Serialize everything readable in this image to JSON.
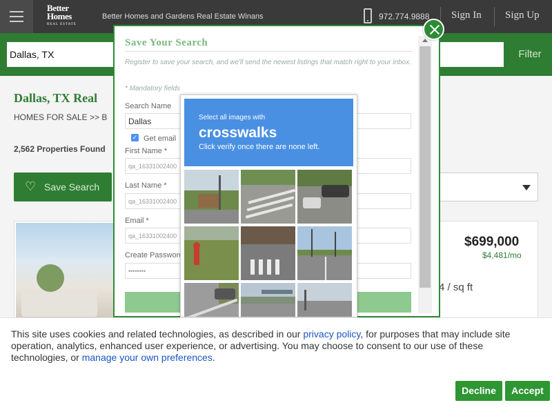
{
  "header": {
    "logo_line1": "Better",
    "logo_line2": "Homes",
    "logo_line3": "and Gardens",
    "logo_line4": "REAL ESTATE",
    "brand": "Better Homes and Gardens Real Estate Winans",
    "phone": "972.774.9888",
    "sign_in": "Sign In",
    "sign_up": "Sign Up"
  },
  "search": {
    "value": "Dallas, TX",
    "filter_label": "Filter"
  },
  "page": {
    "title": "Dallas, TX Real",
    "crumb": "HOMES FOR SALE  >>  B",
    "count": "2,562 Properties Found",
    "save_search": "Save Search"
  },
  "listing": {
    "price": "$699,000",
    "per_month": "$4,481/mo",
    "sqft_fragment": "4 / sq ft"
  },
  "modal": {
    "title": "Save Your Search",
    "intro": "Register to save your search, and we'll send the newest listings that match right to your inbox.",
    "mandatory": "* Mandatory fields",
    "search_name_label": "Search Name",
    "search_name_value": "Dallas",
    "get_email_label": "Get email",
    "first_name_label": "First Name *",
    "first_name_value": "qa_16331002400",
    "last_name_label": "Last Name *",
    "last_name_value": "qa_16331002400",
    "email_label": "Email *",
    "email_value": "qa_16331002400",
    "password_label": "Create Password",
    "password_value": "••••••••"
  },
  "captcha": {
    "instruction_small": "Select all images with",
    "target": "crosswalks",
    "hint": "Click verify once there are none left."
  },
  "cookie": {
    "text_before": "This site uses cookies and related technologies, as described in our ",
    "privacy_link": "privacy policy",
    "text_middle": ", for purposes that may include site operation, analytics, enhanced user experience, or advertising. You may choose to consent to our use of these technologies, or ",
    "prefs_link": "manage your own preferences",
    "text_after": ".",
    "decline": "Decline",
    "accept": "Accept"
  },
  "colors": {
    "brand_green": "#2e7d32",
    "captcha_blue": "#4a90e2",
    "link_blue": "#1a55c4"
  }
}
